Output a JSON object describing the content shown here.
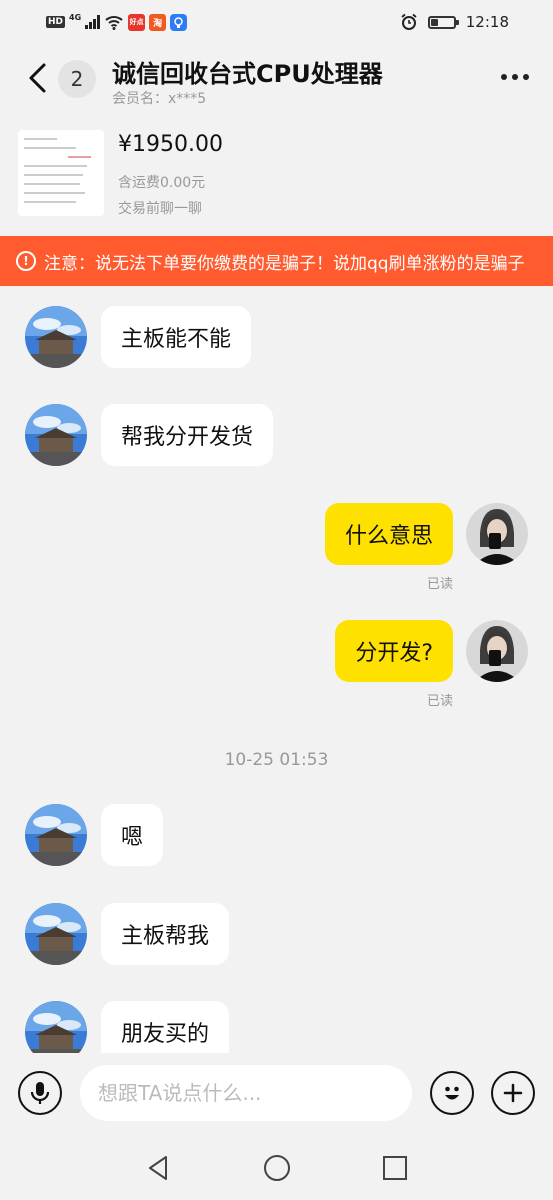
{
  "status_bar": {
    "left_badge": "HD",
    "network": "4G",
    "app_icon_1": "好点",
    "app_icon_2": "淘",
    "time": "12:18",
    "battery_level": 0.35
  },
  "header": {
    "unread_count": "2",
    "title": "诚信回收台式CPU处理器",
    "member_label": "会员名：x***5"
  },
  "product": {
    "price": "¥1950.00",
    "shipping": "含运费0.00元",
    "chat_hint": "交易前聊一聊"
  },
  "warning": {
    "text": "注意：说无法下单要你缴费的是骗子！说加qq刷单涨粉的是骗子"
  },
  "messages": [
    {
      "side": "in",
      "text": "主板能不能"
    },
    {
      "side": "in",
      "text": "帮我分开发货"
    },
    {
      "side": "out",
      "text": "什么意思",
      "status": "已读"
    },
    {
      "side": "out",
      "text": "分开发?",
      "status": "已读"
    },
    {
      "side": "in",
      "text": "嗯"
    },
    {
      "side": "in",
      "text": "主板帮我"
    },
    {
      "side": "in",
      "text": "朋友买的"
    }
  ],
  "timestamp": "10-25 01:53",
  "input": {
    "placeholder": "想跟TA说点什么..."
  },
  "icons": {
    "back": "back-arrow-icon",
    "more": "more-dots-icon",
    "voice": "microphone-icon",
    "emoji": "emoji-icon",
    "plus": "plus-icon",
    "nav_back": "nav-back-icon",
    "nav_home": "nav-home-icon",
    "nav_recent": "nav-recent-icon"
  },
  "colors": {
    "warning_bg": "#ff5b2f",
    "outgoing_bubble": "#ffe100",
    "incoming_bubble": "#ffffff",
    "background": "#f2f2f2"
  }
}
